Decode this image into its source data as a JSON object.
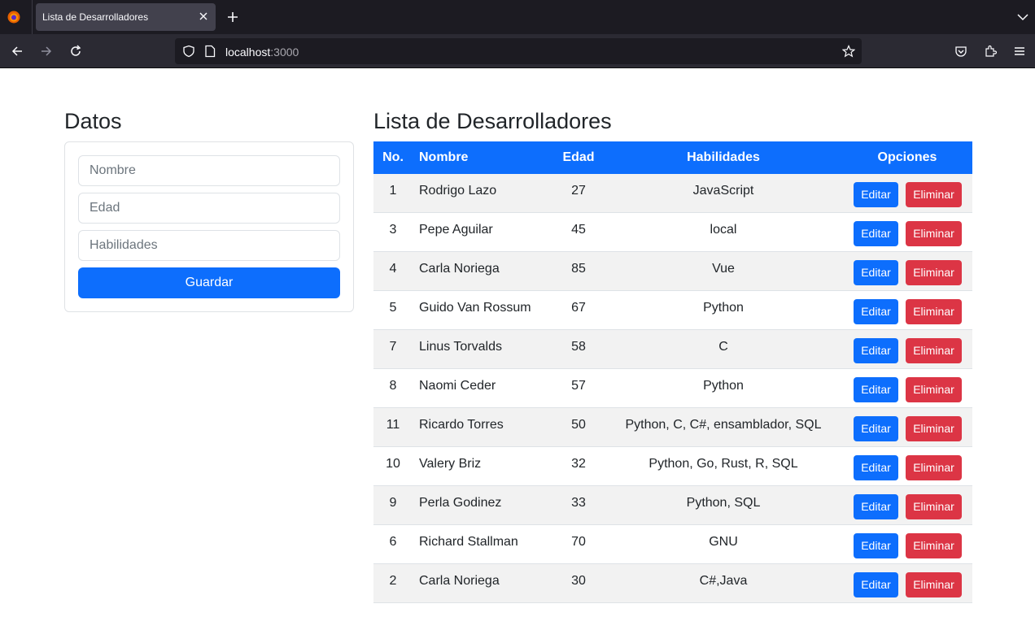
{
  "browser": {
    "tab_title": "Lista de Desarrolladores",
    "url_host": "localhost",
    "url_port": ":3000"
  },
  "form": {
    "heading": "Datos",
    "nombre_placeholder": "Nombre",
    "edad_placeholder": "Edad",
    "habilidades_placeholder": "Habilidades",
    "save_label": "Guardar"
  },
  "list": {
    "heading": "Lista de Desarrolladores",
    "columns": {
      "no": "No.",
      "nombre": "Nombre",
      "edad": "Edad",
      "habilidades": "Habilidades",
      "opciones": "Opciones"
    },
    "edit_label": "Editar",
    "delete_label": "Eliminar",
    "rows": [
      {
        "no": "1",
        "nombre": "Rodrigo Lazo",
        "edad": "27",
        "habilidades": "JavaScript"
      },
      {
        "no": "3",
        "nombre": "Pepe Aguilar",
        "edad": "45",
        "habilidades": "local"
      },
      {
        "no": "4",
        "nombre": "Carla Noriega",
        "edad": "85",
        "habilidades": "Vue"
      },
      {
        "no": "5",
        "nombre": "Guido Van Rossum",
        "edad": "67",
        "habilidades": "Python"
      },
      {
        "no": "7",
        "nombre": "Linus Torvalds",
        "edad": "58",
        "habilidades": "C"
      },
      {
        "no": "8",
        "nombre": "Naomi Ceder",
        "edad": "57",
        "habilidades": "Python"
      },
      {
        "no": "11",
        "nombre": "Ricardo Torres",
        "edad": "50",
        "habilidades": "Python, C, C#, ensamblador, SQL"
      },
      {
        "no": "10",
        "nombre": "Valery Briz",
        "edad": "32",
        "habilidades": "Python, Go, Rust, R, SQL"
      },
      {
        "no": "9",
        "nombre": "Perla Godinez",
        "edad": "33",
        "habilidades": "Python, SQL"
      },
      {
        "no": "6",
        "nombre": "Richard Stallman",
        "edad": "70",
        "habilidades": "GNU"
      },
      {
        "no": "2",
        "nombre": "Carla Noriega",
        "edad": "30",
        "habilidades": "C#,Java"
      }
    ]
  },
  "colors": {
    "primary": "#0d6efd",
    "danger": "#dc3545",
    "stripe": "#f2f2f2"
  }
}
